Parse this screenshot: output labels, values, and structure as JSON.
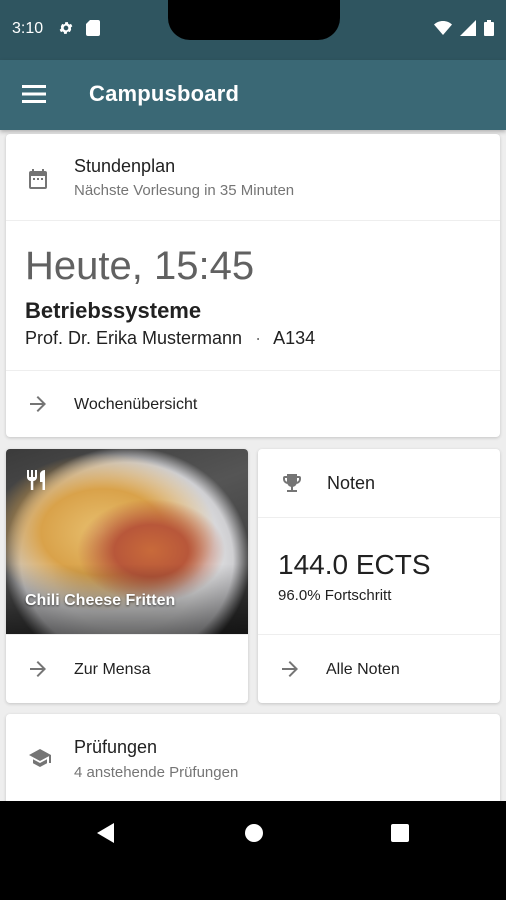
{
  "status_bar": {
    "time": "3:10",
    "icons": [
      "gear-icon",
      "sd-card-icon",
      "wifi-icon",
      "signal-icon",
      "battery-icon"
    ]
  },
  "app_bar": {
    "title": "Campusboard",
    "menu_icon": "menu-icon"
  },
  "schedule": {
    "title": "Stundenplan",
    "subtitle": "Nächste Vorlesung in 35 Minuten",
    "time": "Heute, 15:45",
    "course": "Betriebssysteme",
    "professor": "Prof. Dr. Erika Mustermann",
    "separator": "·",
    "room": "A134",
    "action": "Wochenübersicht"
  },
  "mensa": {
    "dish": "Chili Cheese Fritten",
    "action": "Zur Mensa"
  },
  "grades": {
    "title": "Noten",
    "ects": "144.0 ECTS",
    "progress": "96.0% Fortschritt",
    "action": "Alle Noten"
  },
  "exams": {
    "title": "Prüfungen",
    "subtitle": "4 anstehende Prüfungen"
  },
  "colors": {
    "status_bar": "#2f5560",
    "app_bar": "#3a6875",
    "background": "#eeeeee",
    "card": "#ffffff",
    "secondary_text": "#757575"
  }
}
